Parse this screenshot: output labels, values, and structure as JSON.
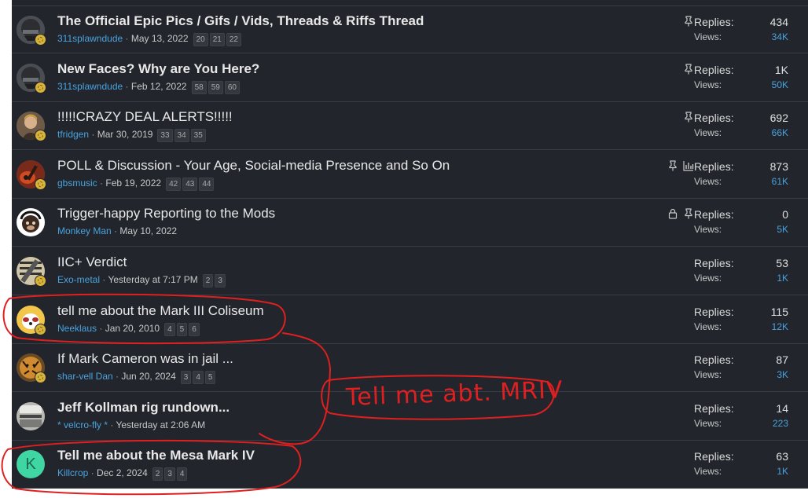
{
  "labels": {
    "replies": "Replies:",
    "views": "Views:"
  },
  "threads": [
    {
      "title": "The Official Epic Pics / Gifs / Vids, Threads & Riffs Thread",
      "bold": true,
      "author": "311splawndude",
      "date": "May 13, 2022",
      "pages": [
        "20",
        "21",
        "22"
      ],
      "replies": "434",
      "views": "34K",
      "icons": [
        "pin-icon"
      ]
    },
    {
      "title": "New Faces? Why are You Here?",
      "bold": true,
      "author": "311splawndude",
      "date": "Feb 12, 2022",
      "pages": [
        "58",
        "59",
        "60"
      ],
      "replies": "1K",
      "views": "50K",
      "icons": [
        "pin-icon"
      ]
    },
    {
      "title": "!!!!!CRAZY DEAL ALERTS!!!!!",
      "bold": false,
      "author": "tfridgen",
      "date": "Mar 30, 2019",
      "pages": [
        "33",
        "34",
        "35"
      ],
      "replies": "692",
      "views": "66K",
      "icons": [
        "pin-icon"
      ]
    },
    {
      "title": "POLL & Discussion - Your Age, Social-media Presence and So On",
      "bold": false,
      "author": "gbsmusic",
      "date": "Feb 19, 2022",
      "pages": [
        "42",
        "43",
        "44"
      ],
      "replies": "873",
      "views": "61K",
      "icons": [
        "pin-icon",
        "poll-icon"
      ]
    },
    {
      "title": "Trigger-happy Reporting to the Mods",
      "bold": false,
      "author": "Monkey Man",
      "date": "May 10, 2022",
      "pages": [],
      "replies": "0",
      "views": "5K",
      "icons": [
        "lock-icon",
        "pin-icon"
      ]
    },
    {
      "title": "IIC+ Verdict",
      "bold": false,
      "author": "Exo-metal",
      "date": "Yesterday at 7:17 PM",
      "pages": [
        "2",
        "3"
      ],
      "replies": "53",
      "views": "1K",
      "icons": []
    },
    {
      "title": "tell me about the Mark III Coliseum",
      "bold": false,
      "author": "Neeklaus",
      "date": "Jan 20, 2010",
      "pages": [
        "4",
        "5",
        "6"
      ],
      "replies": "115",
      "views": "12K",
      "icons": []
    },
    {
      "title": "If Mark Cameron was in jail ...",
      "bold": false,
      "author": "shar-vell Dan",
      "date": "Jun 20, 2024",
      "pages": [
        "3",
        "4",
        "5"
      ],
      "replies": "87",
      "views": "3K",
      "icons": []
    },
    {
      "title": "Jeff Kollman rig rundown...",
      "bold": true,
      "author": "* velcro-fly *",
      "date": "Yesterday at 2:06 AM",
      "pages": [],
      "replies": "14",
      "views": "223",
      "icons": []
    },
    {
      "title": "Tell me about the Mesa Mark IV",
      "bold": true,
      "author": "Killcrop",
      "date": "Dec 2, 2024",
      "pages": [
        "2",
        "3",
        "4"
      ],
      "replies": "63",
      "views": "1K",
      "icons": [],
      "avatar_letter": "K"
    }
  ],
  "annotation": {
    "text": "Tell me abt. MRIV",
    "color": "#e02020"
  },
  "colors": {
    "background": "#22252b",
    "link": "#4aa3df",
    "annotation": "#e02020",
    "avatar_k": "#3fd6a4"
  }
}
